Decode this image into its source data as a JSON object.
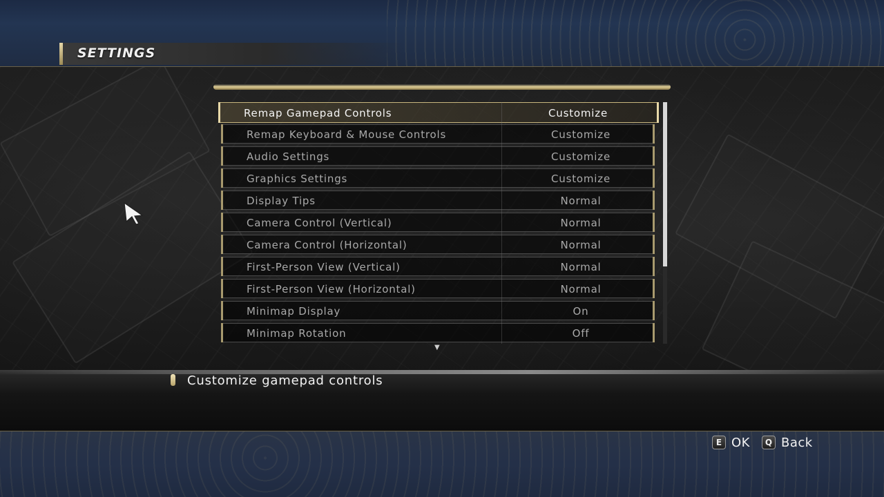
{
  "header": {
    "title": "SETTINGS"
  },
  "settings": {
    "rows": [
      {
        "label": "Remap Gamepad Controls",
        "value": "Customize"
      },
      {
        "label": "Remap Keyboard & Mouse Controls",
        "value": "Customize"
      },
      {
        "label": "Audio Settings",
        "value": "Customize"
      },
      {
        "label": "Graphics Settings",
        "value": "Customize"
      },
      {
        "label": "Display Tips",
        "value": "Normal"
      },
      {
        "label": "Camera Control (Vertical)",
        "value": "Normal"
      },
      {
        "label": "Camera Control (Horizontal)",
        "value": "Normal"
      },
      {
        "label": "First-Person View (Vertical)",
        "value": "Normal"
      },
      {
        "label": "First-Person View (Horizontal)",
        "value": "Normal"
      },
      {
        "label": "Minimap Display",
        "value": "On"
      },
      {
        "label": "Minimap Rotation",
        "value": "Off"
      }
    ],
    "more_indicator": "▼"
  },
  "description": {
    "text": "Customize gamepad controls"
  },
  "footer": {
    "ok": {
      "key": "E",
      "label": "OK"
    },
    "back": {
      "key": "Q",
      "label": "Back"
    }
  },
  "colors": {
    "accent_gold": "#e0cf98",
    "band_blue": "#233552",
    "text_selected": "#f5f5f5",
    "text_normal": "#a9a9a9"
  },
  "icons": {
    "cursor": "pointer-cursor-icon",
    "scroll_more": "scroll-down-arrow-icon"
  }
}
